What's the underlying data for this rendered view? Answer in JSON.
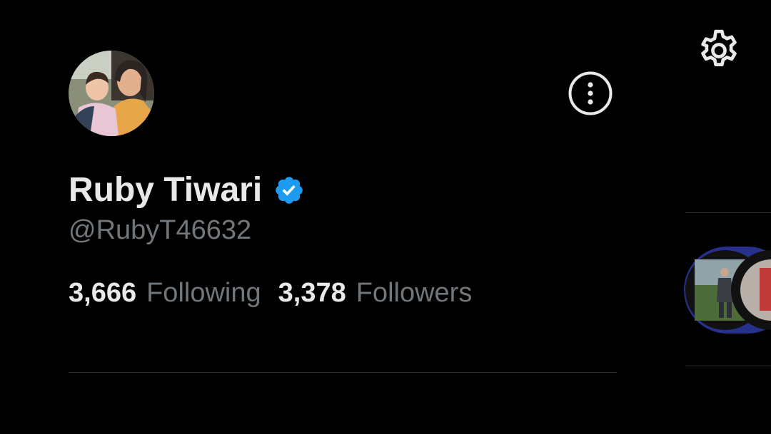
{
  "profile": {
    "display_name": "Ruby Tiwari",
    "handle": "@RubyT46632",
    "verified": true,
    "following_count": "3,666",
    "following_label": "Following",
    "followers_count": "3,378",
    "followers_label": "Followers"
  },
  "icons": {
    "more": "more-vertical-icon",
    "settings": "gear-icon",
    "verified": "verified-badge-icon"
  },
  "colors": {
    "background": "#000000",
    "primary_text": "#e7e9ea",
    "secondary_text": "#71767b",
    "verified_blue": "#1d9bf0",
    "divider": "#2f3336",
    "story_ring": "#27308a"
  }
}
